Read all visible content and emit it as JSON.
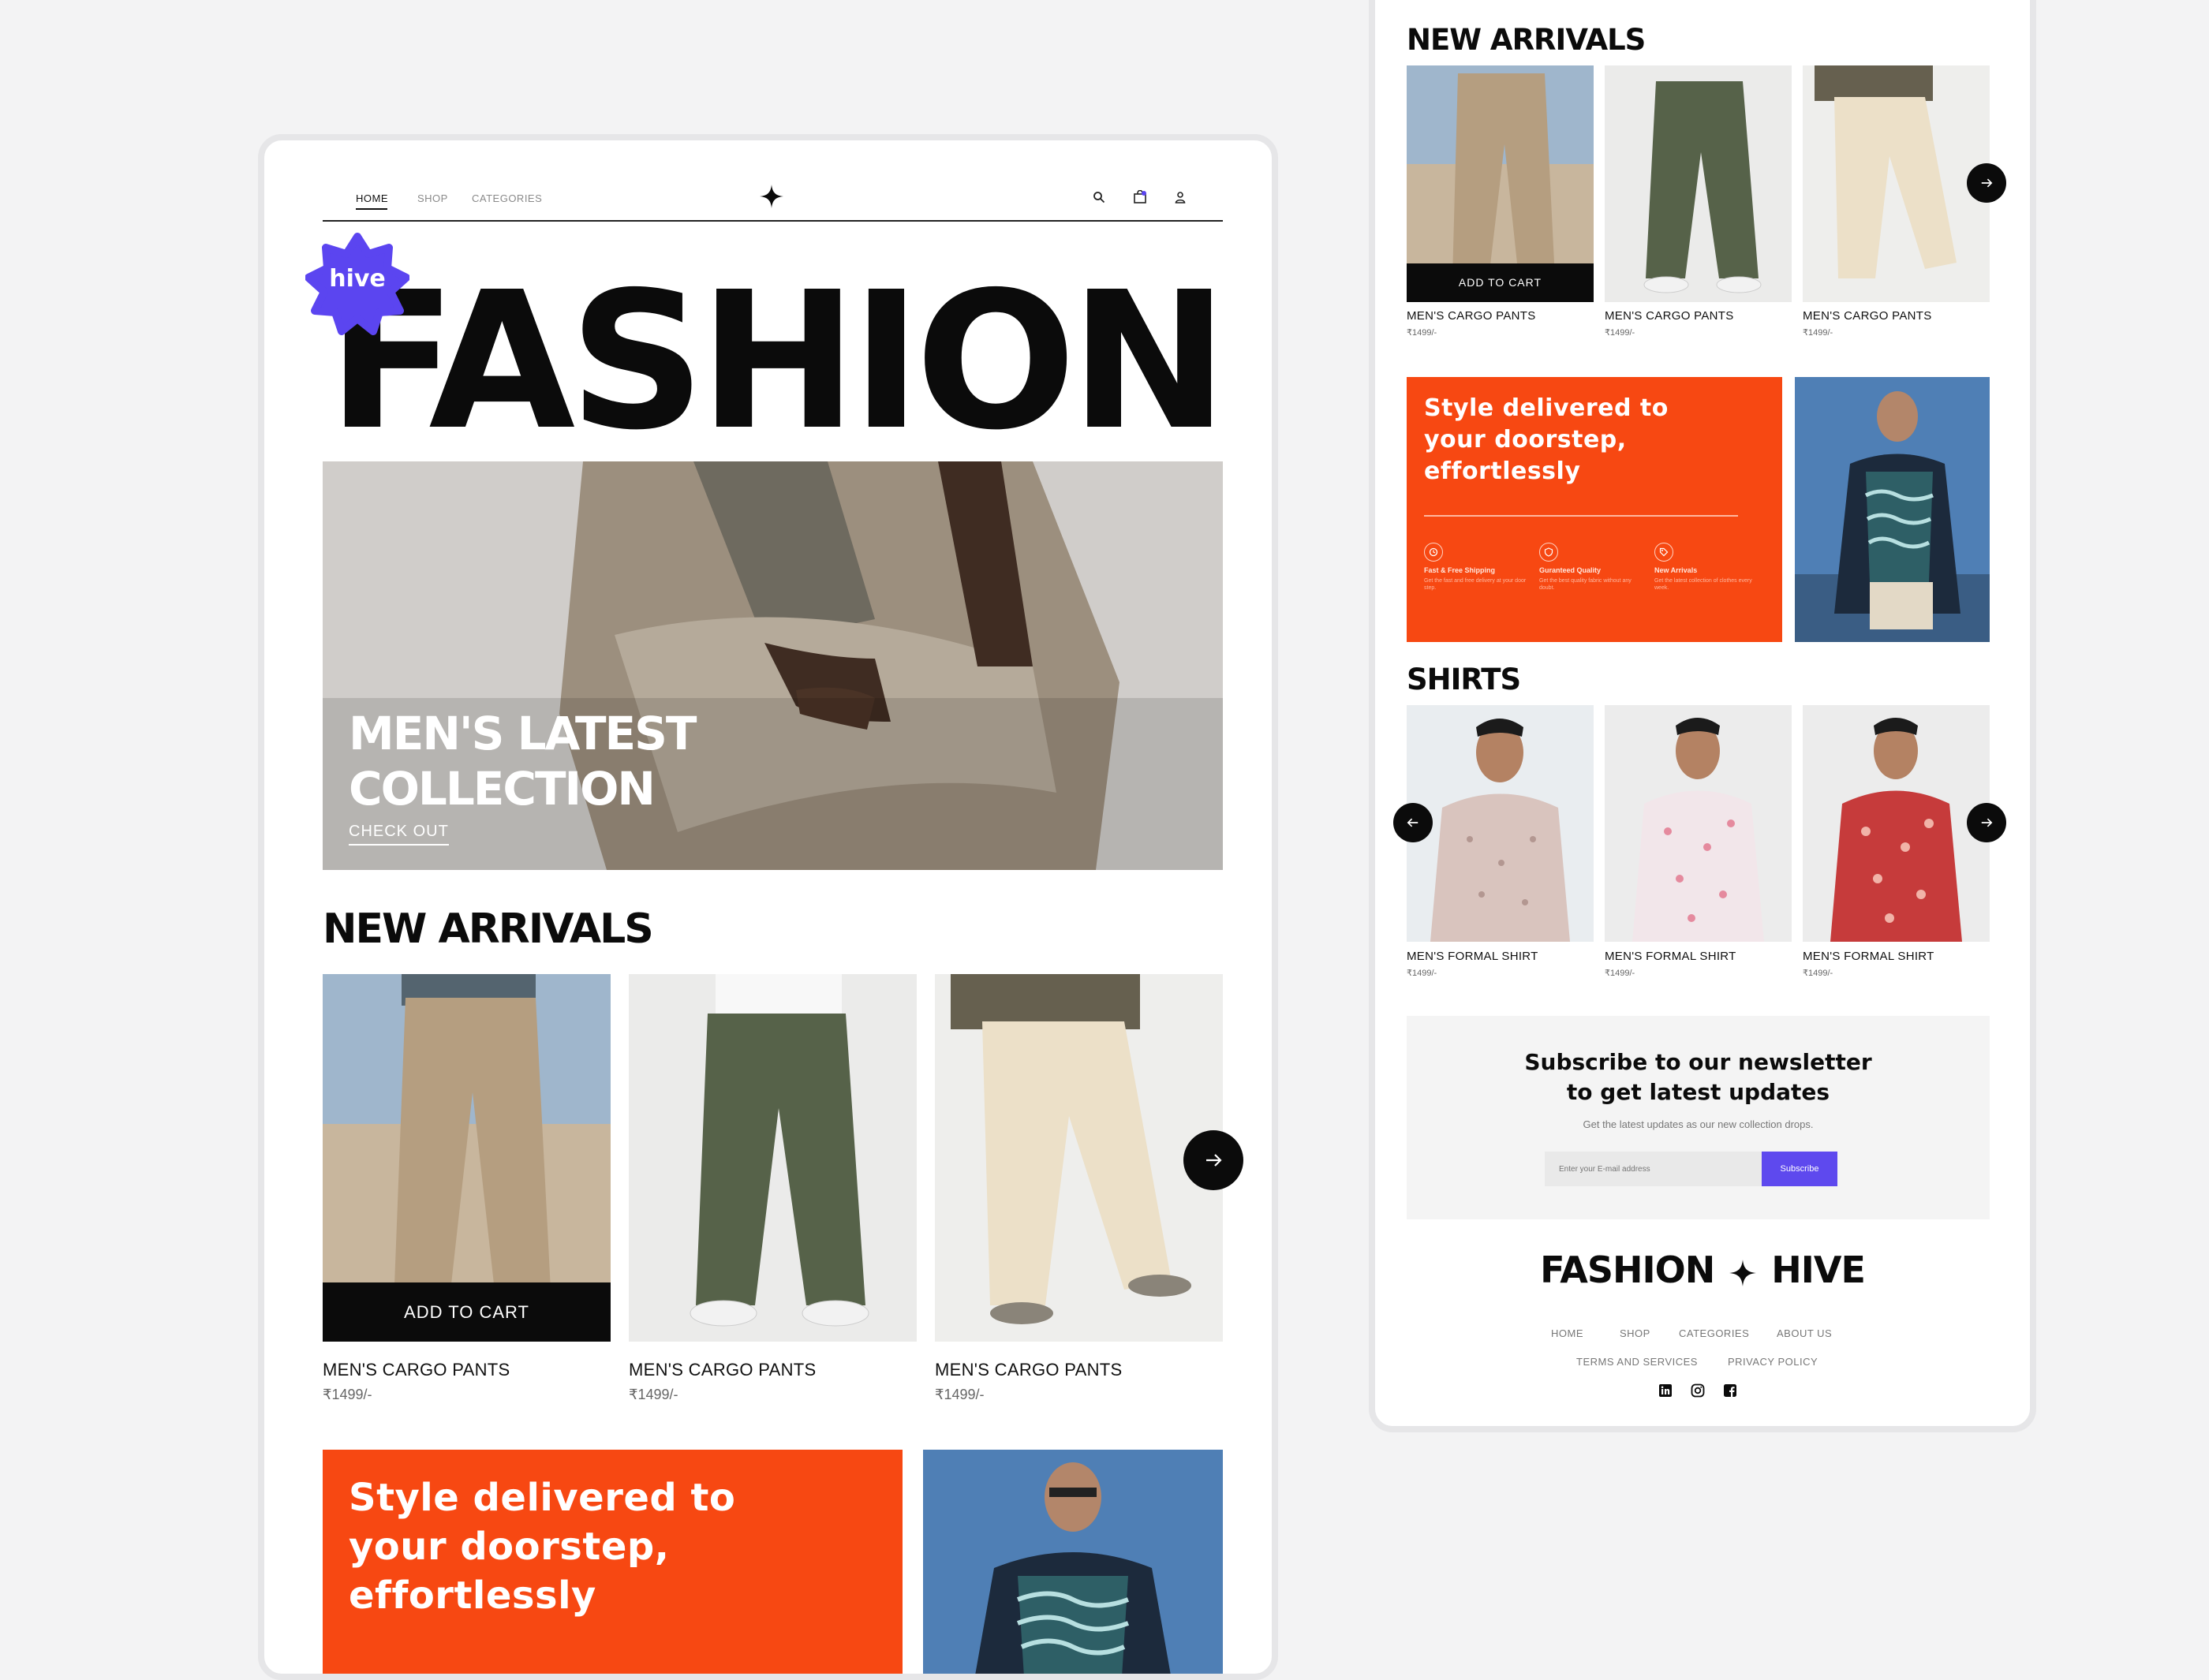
{
  "colors": {
    "accent_orange": "#f74812",
    "badge_purple": "#5b45f0",
    "subscribe_button": "#5e49ee",
    "ink": "#0b0b0b"
  },
  "nav": {
    "items": [
      "HOME",
      "SHOP",
      "CATEGORIES"
    ],
    "active": "HOME",
    "icons": [
      "search-icon",
      "cart-icon",
      "user-icon"
    ]
  },
  "brand": {
    "badge": "hive",
    "hero_word": "FASHION",
    "logo_left": "FASHION",
    "logo_right": "HIVE"
  },
  "hero": {
    "title_line1": "MEN'S LATEST",
    "title_line2": "COLLECTION",
    "cta": "CHECK OUT"
  },
  "new_arrivals": {
    "title": "NEW ARRIVALS",
    "add_to_cart": "ADD TO CART",
    "products": [
      {
        "name": "MEN'S CARGO PANTS",
        "price": "₹1499/-"
      },
      {
        "name": "MEN'S CARGO PANTS",
        "price": "₹1499/-"
      },
      {
        "name": "MEN'S CARGO PANTS",
        "price": "₹1499/-"
      }
    ]
  },
  "promo": {
    "line1": "Style delivered to",
    "line2": "your doorstep,",
    "line3": "effortlessly",
    "features": [
      {
        "title": "Fast & Free Shipping",
        "desc": "Get the fast and free delivery at your door step.",
        "icon": "clock-icon"
      },
      {
        "title": "Guranteed Quality",
        "desc": "Get the best quality fabric without any doubt.",
        "icon": "shield-icon"
      },
      {
        "title": "New Arrivals",
        "desc": "Get the latest collection of clothes every week.",
        "icon": "tag-icon"
      }
    ]
  },
  "shirts": {
    "title": "SHIRTS",
    "products": [
      {
        "name": "MEN'S FORMAL SHIRT",
        "price": "₹1499/-"
      },
      {
        "name": "MEN'S FORMAL SHIRT",
        "price": "₹1499/-"
      },
      {
        "name": "MEN'S FORMAL SHIRT",
        "price": "₹1499/-"
      }
    ]
  },
  "newsletter": {
    "title_line1": "Subscribe to our newsletter",
    "title_line2": "to get latest updates",
    "subtitle": "Get the latest updates  as our new collection drops.",
    "placeholder": "Enter your E-mail address",
    "button": "Subscribe"
  },
  "footer": {
    "links_row1": [
      "HOME",
      "SHOP",
      "CATEGORIES",
      "ABOUT US"
    ],
    "links_row2": [
      "TERMS AND SERVICES",
      "PRIVACY POLICY"
    ],
    "social": [
      "linkedin-icon",
      "instagram-icon",
      "facebook-icon"
    ]
  }
}
